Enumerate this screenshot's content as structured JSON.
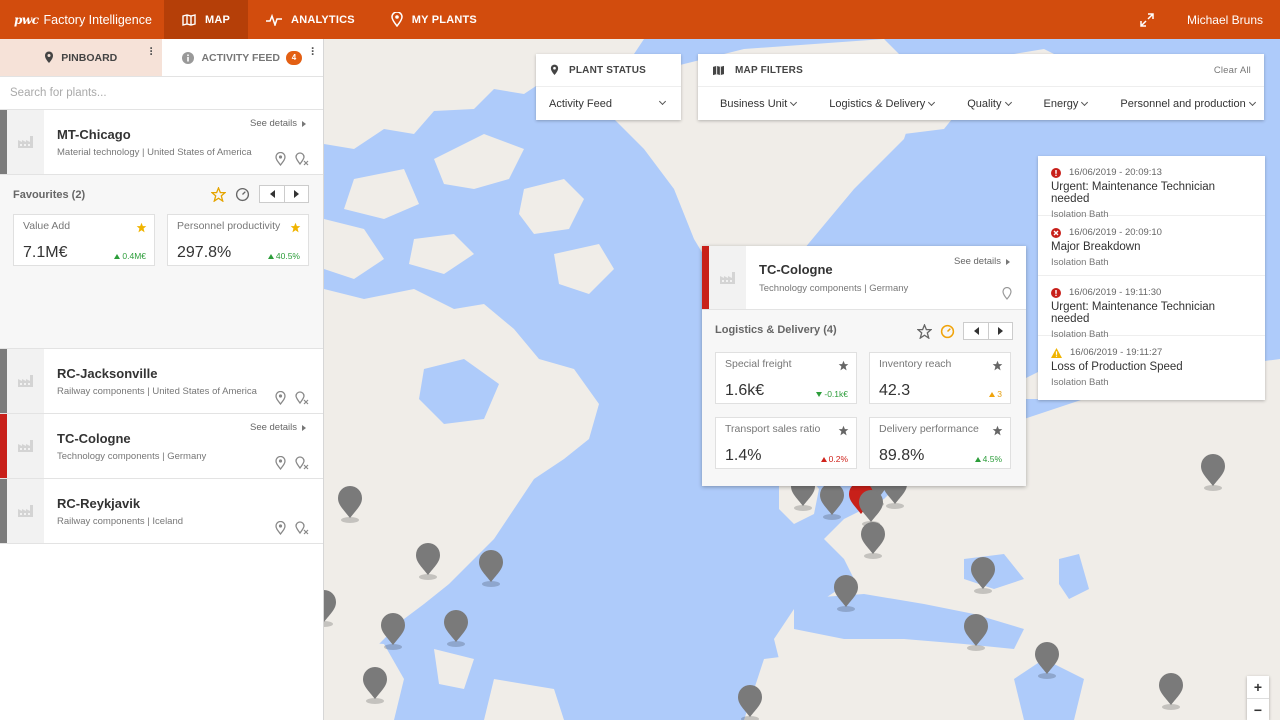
{
  "topbar": {
    "logo": "pwc",
    "app_name": "Factory Intelligence",
    "nav": [
      {
        "label": "MAP",
        "icon": "map-icon",
        "active": true
      },
      {
        "label": "ANALYTICS",
        "icon": "pulse-icon",
        "active": false
      },
      {
        "label": "MY PLANTS",
        "icon": "location-pin-icon",
        "active": false
      }
    ],
    "user": "Michael Bruns"
  },
  "sidebar": {
    "tabs": {
      "pinboard": "PINBOARD",
      "activity_feed": "ACTIVITY FEED",
      "activity_count": "4"
    },
    "search_placeholder": "Search for plants...",
    "see_details": "See details",
    "plants": [
      {
        "name": "MT-Chicago",
        "sub": "Material technology | United States of America",
        "status": "gray"
      },
      {
        "name": "RC-Jacksonville",
        "sub": "Railway components | United States of America",
        "status": "gray"
      },
      {
        "name": "TC-Cologne",
        "sub": "Technology components | Germany",
        "status": "red"
      },
      {
        "name": "RC-Reykjavik",
        "sub": "Railway components | Iceland",
        "status": "gray"
      }
    ],
    "favourites": {
      "title": "Favourites (2)",
      "kpis": [
        {
          "label": "Value Add",
          "value": "7.1M€",
          "delta": "0.4M€",
          "trend": "up"
        },
        {
          "label": "Personnel productivity",
          "value": "297.8%",
          "delta": "40.5%",
          "trend": "up"
        }
      ]
    }
  },
  "plant_status": {
    "title": "PLANT STATUS",
    "selected": "Activity Feed"
  },
  "map_filters": {
    "title": "MAP FILTERS",
    "clear_all": "Clear All",
    "filters": [
      "Business Unit",
      "Logistics & Delivery",
      "Quality",
      "Energy",
      "Personnel and production"
    ]
  },
  "notifications": [
    {
      "time": "16/06/2019 - 20:09:13",
      "message": "Urgent: Maintenance Technician needed",
      "plant": "Isolation Bath",
      "level": "urgent"
    },
    {
      "time": "16/06/2019 - 20:09:10",
      "message": "Major Breakdown",
      "plant": "Isolation Bath",
      "level": "error"
    },
    {
      "time": "16/06/2019 - 19:11:30",
      "message": "Urgent: Maintenance Technician needed",
      "plant": "Isolation Bath",
      "level": "urgent"
    },
    {
      "time": "16/06/2019 - 19:11:27",
      "message": "Loss of Production Speed",
      "plant": "Isolation Bath",
      "level": "warning"
    }
  ],
  "popup": {
    "name": "TC-Cologne",
    "sub": "Technology components | Germany",
    "see_details": "See details",
    "section": "Logistics & Delivery (4)",
    "kpis": [
      {
        "label": "Special freight",
        "value": "1.6k€",
        "delta": "-0.1k€",
        "trend": "down-good"
      },
      {
        "label": "Inventory reach",
        "value": "42.3",
        "delta": "3",
        "trend": "up-warn"
      },
      {
        "label": "Transport sales ratio",
        "value": "1.4%",
        "delta": "0.2%",
        "trend": "up-bad"
      },
      {
        "label": "Delivery performance",
        "value": "89.8%",
        "delta": "4.5%",
        "trend": "up"
      }
    ]
  },
  "zoom": {
    "in": "+",
    "out": "−"
  },
  "colors": {
    "brand": "#d24c0d",
    "alert_red": "#c8201a",
    "positive": "#2c9d3a",
    "warning": "#f0a30a",
    "water": "#aecbfa",
    "land": "#f0ede8"
  }
}
